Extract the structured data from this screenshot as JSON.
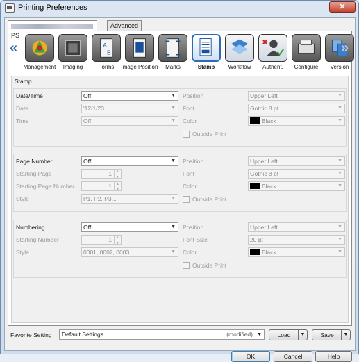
{
  "window": {
    "title": "Printing Preferences",
    "close_label": "✕"
  },
  "tabs": [
    {
      "label": "PS"
    },
    {
      "label": "Advanced"
    }
  ],
  "function_bar": {
    "items": [
      {
        "label": "Management",
        "icon": "management-icon"
      },
      {
        "label": "Imaging",
        "icon": "imaging-icon"
      },
      {
        "label": "Forms",
        "icon": "forms-icon"
      },
      {
        "label": "Image Position",
        "icon": "image-position-icon"
      },
      {
        "label": "Marks",
        "icon": "marks-icon"
      },
      {
        "label": "Stamp",
        "icon": "stamp-icon",
        "selected": true
      },
      {
        "label": "Workflow",
        "icon": "workflow-icon"
      },
      {
        "label": "Authent.",
        "icon": "authent-icon"
      },
      {
        "label": "Configure",
        "icon": "configure-icon"
      },
      {
        "label": "Version",
        "icon": "version-icon"
      }
    ],
    "scroll_left": "«",
    "scroll_right": "»"
  },
  "stamp": {
    "section_title": "Stamp",
    "datetime": {
      "label": "Date/Time",
      "value": "Off",
      "date_label": "Date",
      "date_value": "'12/1/23",
      "time_label": "Time",
      "time_value": "Off",
      "position_label": "Position",
      "position_value": "Upper Left",
      "font_label": "Font",
      "font_value": "Gothic 8 pt",
      "color_label": "Color",
      "color_value": "Black",
      "outside_print_label": "Outside Print"
    },
    "page_number": {
      "label": "Page Number",
      "value": "Off",
      "starting_page_label": "Starting Page",
      "starting_page_value": "1",
      "starting_page_number_label": "Starting Page Number",
      "starting_page_number_value": "1",
      "style_label": "Style",
      "style_value": "P1, P2, P3...",
      "position_label": "Position",
      "position_value": "Upper Left",
      "font_label": "Font",
      "font_value": "Gothic 8 pt",
      "color_label": "Color",
      "color_value": "Black",
      "outside_print_label": "Outside Print"
    },
    "numbering": {
      "label": "Numbering",
      "value": "Off",
      "starting_number_label": "Starting Number",
      "starting_number_value": "1",
      "style_label": "Style",
      "style_value": "0001, 0002, 0003...",
      "position_label": "Position",
      "position_value": "Upper Left",
      "font_size_label": "Font Size",
      "font_size_value": "20 pt",
      "color_label": "Color",
      "color_value": "Black",
      "outside_print_label": "Outside Print"
    }
  },
  "favorite": {
    "label": "Favorite Setting",
    "value": "Default Settings",
    "modified": "(modified)",
    "load_label": "Load",
    "save_label": "Save"
  },
  "buttons": {
    "ok": "OK",
    "cancel": "Cancel",
    "help": "Help"
  },
  "colors": {
    "accent": "#2f6bb3",
    "swatch": "#000000"
  }
}
